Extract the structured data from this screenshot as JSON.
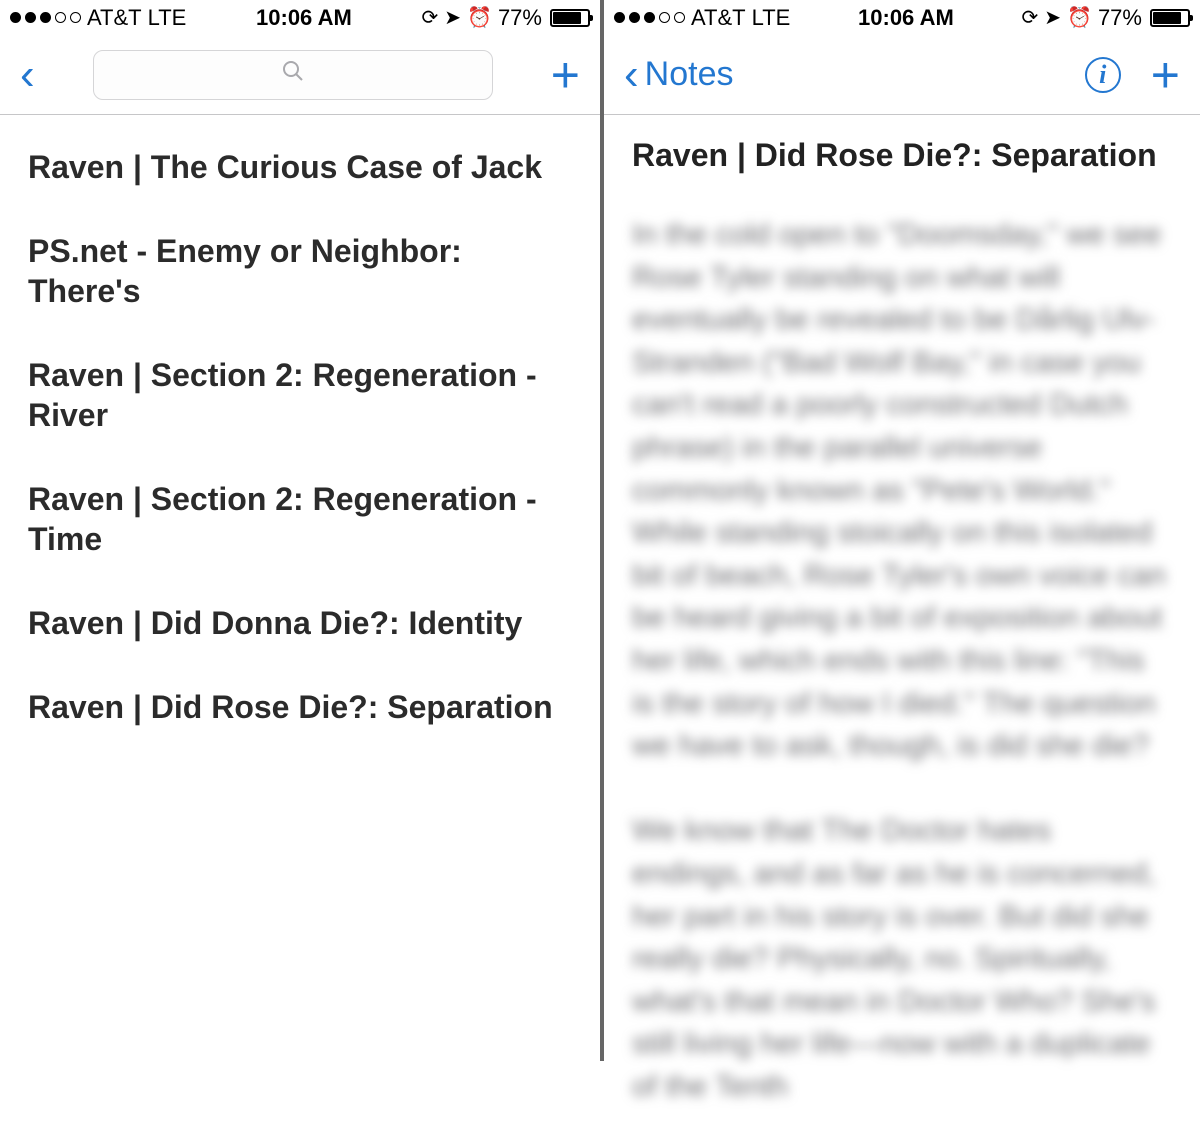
{
  "status_bar": {
    "carrier": "AT&T",
    "network": "LTE",
    "time": "10:06 AM",
    "battery_percent": "77%",
    "battery_fill_pct": 77,
    "signal_filled": 3,
    "signal_total": 5
  },
  "list_panel": {
    "back_visible": true,
    "items": [
      "Raven | The Curious Case of Jack",
      "PS.net  - Enemy or Neighbor: There's",
      "Raven | Section 2: Regeneration - River",
      "Raven | Section 2: Regeneration - Time",
      "Raven | Did Donna Die?: Identity",
      "Raven | Did Rose Die?: Separation"
    ]
  },
  "detail_panel": {
    "back_label": "Notes",
    "title": "Raven | Did Rose Die?: Separation",
    "body": "In the cold open to \"Doomsday,\" we see Rose Tyler standing on what will eventually be revealed to be Dårlig Ulv-Stranden (\"Bad Wolf Bay,\" in case you can't read a poorly constructed Dutch phrase) in the parallel universe commonly known as \"Pete's World.\" While standing stoically on this isolated bit of beach, Rose Tyler's own voice can be heard giving a bit of exposition about her life, which ends with this line: \"This is the story of how I died.\" The question we have to ask, though, is did she die?\n\nWe know that The Doctor hates endings, and as far as he is concerned, her part in his story is over. But did she really die? Physically, no. Spiritually, what's that mean in Doctor Who? She's still living her life—now with a duplicate of the Tenth"
  }
}
